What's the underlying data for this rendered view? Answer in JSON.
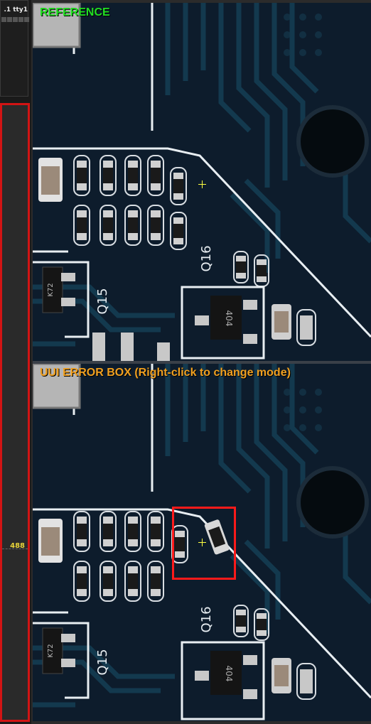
{
  "sidebar": {
    "top_label": ".1 tty1",
    "value_label": "488"
  },
  "reference_view": {
    "title": "REFERENCE"
  },
  "error_view": {
    "title": "UUI ERROR BOX (Right-click to change mode)"
  },
  "board": {
    "silkscreen": [
      "Q16",
      "Q15",
      "K72",
      "K72",
      "404"
    ],
    "colors": {
      "reference_label": "#22e022",
      "error_label": "#f0a020",
      "error_box": "#ff1a1a",
      "crosshair": "#ffff40",
      "sidebar_border": "#d21414"
    }
  }
}
